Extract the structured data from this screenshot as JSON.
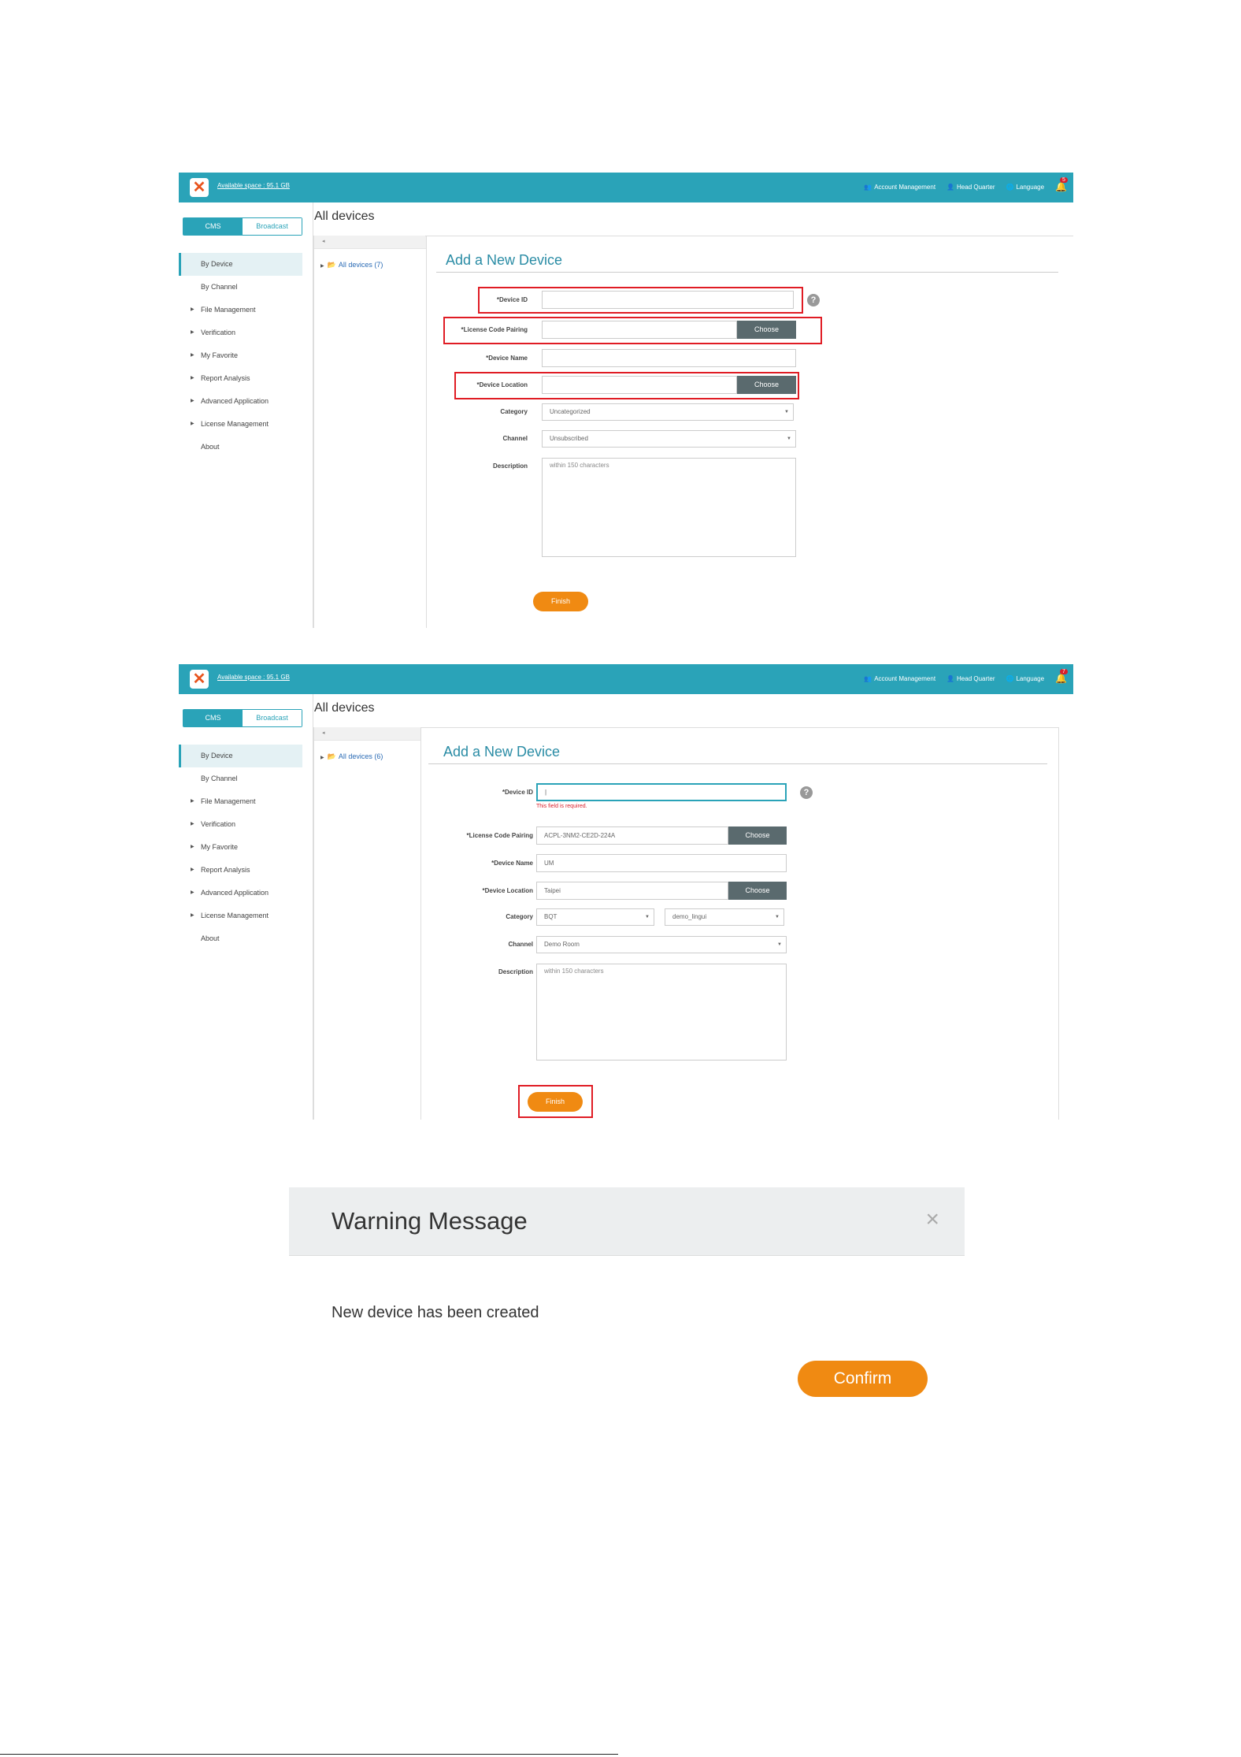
{
  "topbar": {
    "available_space": "Available space : 95.1 GB",
    "account_management": "Account Management",
    "head_quarter": "Head Quarter",
    "language": "Language",
    "notifications_1": "5",
    "notifications_2": "7"
  },
  "sidebar": {
    "tab_cms": "CMS",
    "tab_broadcast": "Broadcast",
    "items": [
      {
        "label": "By Device",
        "expandable": false,
        "active": true
      },
      {
        "label": "By Channel",
        "expandable": false,
        "active": false
      },
      {
        "label": "File Management",
        "expandable": true,
        "active": false
      },
      {
        "label": "Verification",
        "expandable": true,
        "active": false
      },
      {
        "label": "My Favorite",
        "expandable": true,
        "active": false
      },
      {
        "label": "Report Analysis",
        "expandable": true,
        "active": false
      },
      {
        "label": "Advanced Application",
        "expandable": true,
        "active": false
      },
      {
        "label": "License Management",
        "expandable": true,
        "active": false
      },
      {
        "label": "About",
        "expandable": false,
        "active": false
      }
    ]
  },
  "page_title": "All devices",
  "screens": [
    {
      "tree_node": "All devices (7)",
      "form": {
        "title": "Add a New Device",
        "device_id_label": "*Device ID",
        "device_id_value": "",
        "license_label": "*License Code Pairing",
        "license_value": "",
        "device_name_label": "*Device Name",
        "device_name_value": "",
        "device_location_label": "*Device Location",
        "device_location_value": "",
        "category_label": "Category",
        "category_value": "Uncategorized",
        "channel_label": "Channel",
        "channel_value": "Unsubscribed",
        "description_label": "Description",
        "description_placeholder": "within 150 characters",
        "choose_label": "Choose",
        "finish_label": "Finish"
      }
    },
    {
      "tree_node": "All devices (6)",
      "form": {
        "title": "Add a New Device",
        "device_id_label": "*Device ID",
        "device_id_value": "|",
        "error_text": "This field is required.",
        "license_label": "*License Code Pairing",
        "license_value": "ACPL-3NM2-CE2D-224A",
        "device_name_label": "*Device Name",
        "device_name_value": "UM",
        "device_location_label": "*Device Location",
        "device_location_value": "Taipei",
        "category_label": "Category",
        "category_value": "BQT",
        "category_sub_value": "demo_lingui",
        "channel_label": "Channel",
        "channel_value": "Demo Room",
        "description_label": "Description",
        "description_placeholder": "within 150 characters",
        "choose_label": "Choose",
        "finish_label": "Finish"
      }
    }
  ],
  "dialog": {
    "title": "Warning Message",
    "close": "×",
    "message": "New device has been created",
    "confirm_label": "Confirm"
  },
  "icons": [
    "logo-icon",
    "users-icon",
    "user-icon",
    "globe-icon",
    "bell-icon",
    "folder-icon",
    "help-icon",
    "close-icon",
    "caret-right-icon",
    "caret-down-icon"
  ],
  "colors": {
    "accent": "#2aa3b8",
    "orange": "#f08a12",
    "highlight_red": "#e01c24",
    "choose_btn": "#5a6a6e"
  }
}
